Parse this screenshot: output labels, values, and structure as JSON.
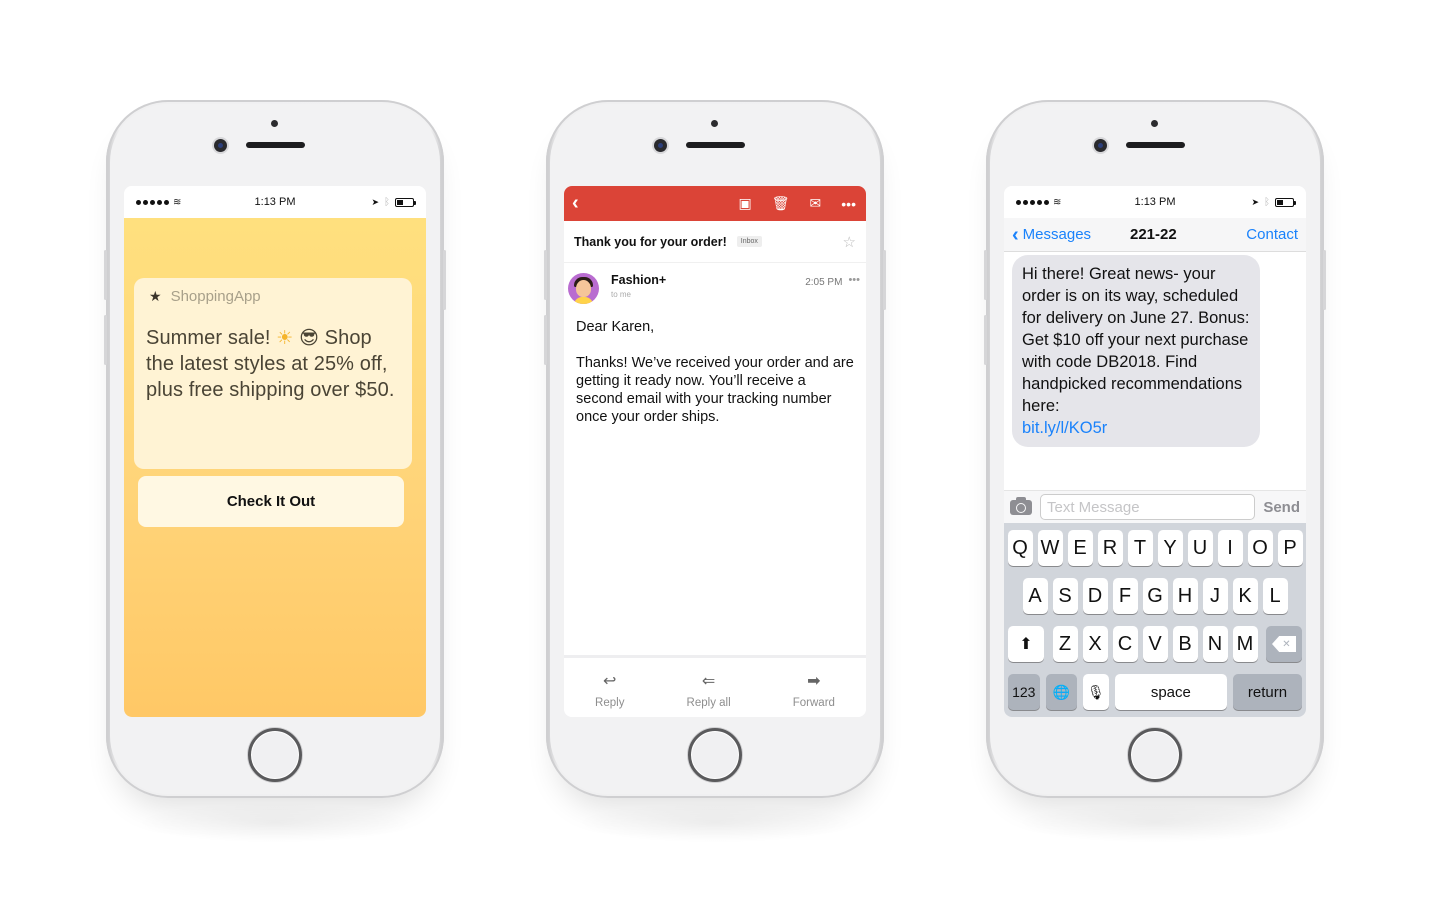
{
  "phones": {
    "push": {
      "status": {
        "time": "1:13 PM"
      },
      "notification": {
        "app_name": "ShoppingApp",
        "app_icon": "star-icon",
        "message_prefix": "Summer sale!",
        "emoji_1": "☀",
        "emoji_2": "😎",
        "message_suffix": "Shop the latest styles at 25% off, plus free shipping over $50.",
        "cta_label": "Check It Out"
      },
      "colors": {
        "background_top": "#ffe07e",
        "background_bottom": "#ffc866",
        "card": "#fff3d4"
      }
    },
    "email": {
      "toolbar": {
        "back_icon": "chevron-left-icon",
        "actions": [
          "archive-icon",
          "trash-icon",
          "mail-icon",
          "more-icon"
        ],
        "color": "#db4437"
      },
      "subject": "Thank you for your order!",
      "label_badge": "Inbox",
      "sender": {
        "name": "Fashion+",
        "to": "to me",
        "time": "2:05 PM"
      },
      "body": {
        "greeting": "Dear Karen,",
        "paragraph": "Thanks! We’ve received your order and are getting it ready now. You’ll receive a second email with your tracking number once your order ships."
      },
      "footer": [
        {
          "label": "Reply",
          "icon": "reply-icon"
        },
        {
          "label": "Reply all",
          "icon": "reply-all-icon"
        },
        {
          "label": "Forward",
          "icon": "forward-icon"
        }
      ]
    },
    "sms": {
      "status": {
        "time": "1:13 PM"
      },
      "nav": {
        "back_label": "Messages",
        "title": "221-22",
        "contact_label": "Contact"
      },
      "message": {
        "text": "Hi there! Great news- your order is on its way, scheduled for delivery on June 27. Bonus: Get $10 off your next purchase with code DB2018. Find handpicked recommendations here:",
        "link": "bit.ly/l/KO5r"
      },
      "compose": {
        "placeholder": "Text Message",
        "value": "",
        "send_label": "Send"
      },
      "keyboard": {
        "row1": [
          "Q",
          "W",
          "E",
          "R",
          "T",
          "Y",
          "U",
          "I",
          "O",
          "P"
        ],
        "row2": [
          "A",
          "S",
          "D",
          "F",
          "G",
          "H",
          "J",
          "K",
          "L"
        ],
        "row3": [
          "Z",
          "X",
          "C",
          "V",
          "B",
          "N",
          "M"
        ],
        "numbers_label": "123",
        "space_label": "space",
        "return_label": "return"
      },
      "colors": {
        "link": "#1a82fb",
        "bubble": "#e5e5ea"
      }
    }
  }
}
